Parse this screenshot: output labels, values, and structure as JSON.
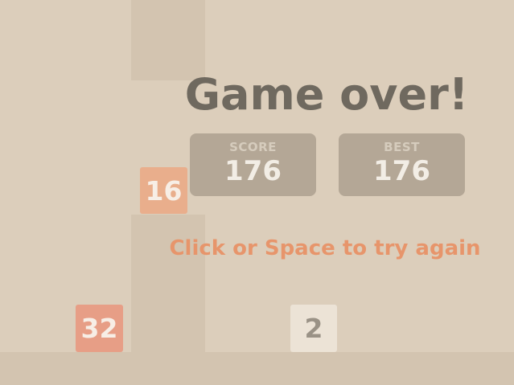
{
  "game": {
    "tiles": [
      {
        "value": "16"
      },
      {
        "value": "32"
      },
      {
        "value": "2"
      }
    ],
    "colors": {
      "background": "#dccebb",
      "pillar": "#d3c4b0",
      "tile_16": "#e9ae8c",
      "tile_32": "#e79e86",
      "tile_2": "#ece3d6",
      "accent": "#e7956b"
    }
  },
  "overlay": {
    "title": "Game over!",
    "score_label": "SCORE",
    "score_value": "176",
    "best_label": "BEST",
    "best_value": "176",
    "retry_text": "Click or Space to try again"
  }
}
